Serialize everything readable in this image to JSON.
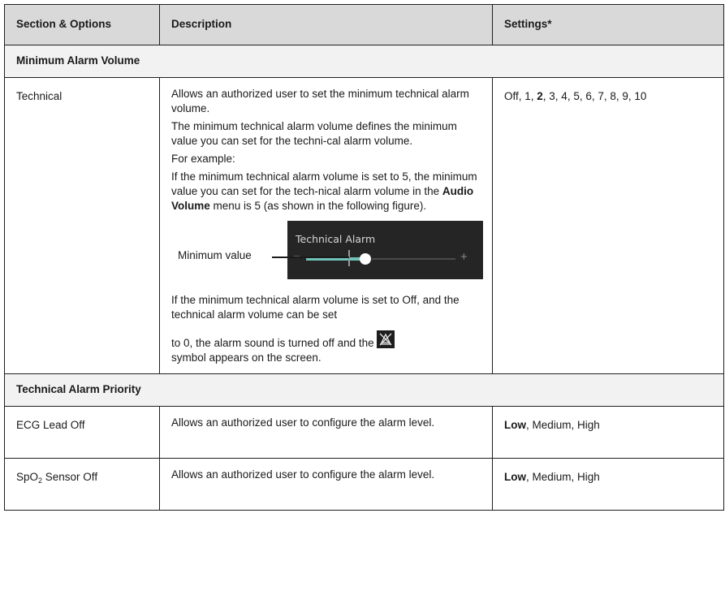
{
  "table": {
    "headers": [
      "Section & Options",
      "Description",
      "Settings*"
    ],
    "sections": {
      "min_alarm_volume": "Minimum Alarm Volume",
      "tech_alarm_priority": "Technical Alarm Priority"
    },
    "technical": {
      "name": "Technical",
      "p1": "Allows an authorized user to set the minimum technical alarm volume.",
      "p2": "The minimum technical alarm volume defines the minimum value you can set for the techni-cal alarm volume.",
      "p3": "For example:",
      "p4_a": "If the minimum technical alarm volume is set to 5, the minimum value you can set for the tech-nical alarm volume in the ",
      "p4_bold": "Audio Volume",
      "p4_b": " menu is 5 (as shown in the following figure).",
      "p5": "If the minimum technical alarm volume is set to Off, and the technical alarm volume can be set",
      "p6_a": "to 0, the alarm sound is turned off and the ",
      "p6_b": "symbol appears on the screen.",
      "settings_a": "Off, 1, ",
      "settings_bold": "2",
      "settings_b": ", 3, 4, 5, 6, 7, 8, 9, 10"
    },
    "figure": {
      "title": "Technical Alarm",
      "minimum_label": "Minimum value",
      "minus": "−",
      "plus": "+",
      "min_setting": 5
    },
    "ecg": {
      "name": "ECG Lead Off",
      "desc": "Allows an authorized user to configure the alarm level.",
      "settings_bold": "Low",
      "settings_rest": ", Medium, High"
    },
    "spo2": {
      "name_a": "SpO",
      "name_sub": "2",
      "name_b": " Sensor Off",
      "desc": "Allows an authorized user to configure the alarm level.",
      "settings_bold": "Low",
      "settings_rest": ", Medium, High"
    }
  },
  "icons": {
    "alarm_off": "alarm-sound-off-icon"
  }
}
